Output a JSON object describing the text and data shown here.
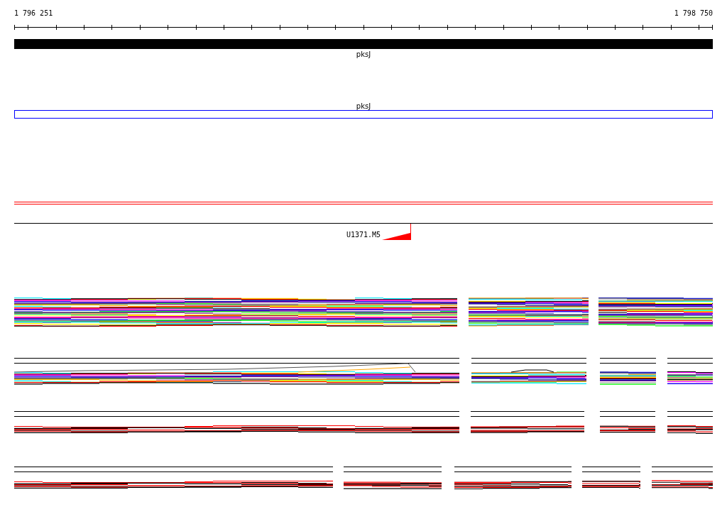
{
  "ruler": {
    "start": "1 796 251",
    "end": "1 798 750"
  },
  "tracks": [
    {
      "kind": "gene",
      "label": "pksJ"
    },
    {
      "kind": "feature",
      "label": "pksJ"
    },
    {
      "kind": "strands"
    },
    {
      "kind": "marker",
      "label": "U1371.M5"
    },
    {
      "kind": "reads"
    },
    {
      "kind": "paired"
    },
    {
      "kind": "paired"
    },
    {
      "kind": "paired"
    }
  ]
}
